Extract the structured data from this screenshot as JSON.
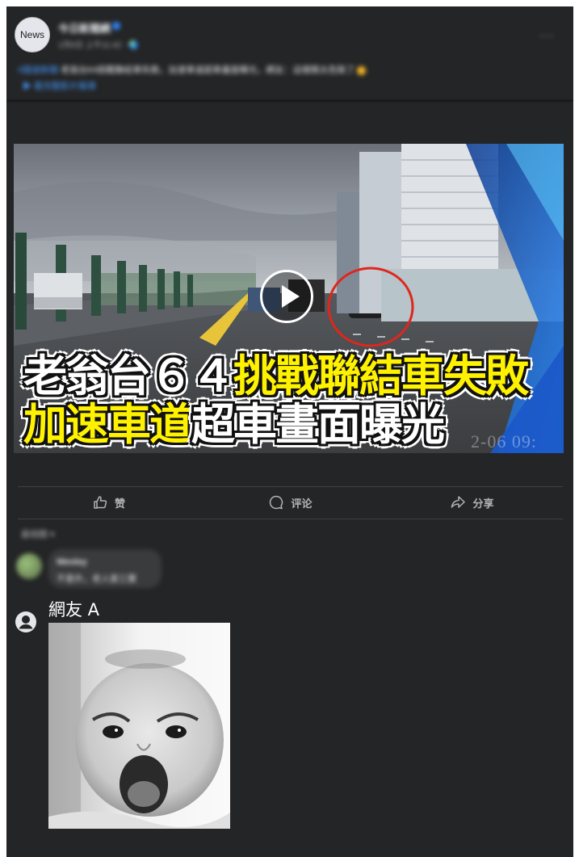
{
  "post": {
    "avatar_text": "News",
    "page_name": "今日新聞網",
    "meta": "1月6日 上午11:42 · 🌏",
    "more_label": "···",
    "text_tag": "#國道新聞",
    "text": "老翁台64挑戰聯結車失敗，加速車道超車畫面曝光，網友：這樣開太危險了",
    "text_link": "▶ 看完整影片報導"
  },
  "video": {
    "headline_line1_white": "老翁台６４",
    "headline_line1_yellow": "挑戰聯結車失敗",
    "headline_line2_yellow": "加速車道",
    "headline_line2_white": "超車畫面曝光",
    "timestamp": "2-06 09:"
  },
  "actions": {
    "like": "赞",
    "comment": "评论",
    "share": "分享"
  },
  "comments": {
    "sort_label": "最相關 ▾",
    "first_name": "Wesley",
    "first_body": "不意外，老人家三寶"
  },
  "reply": {
    "user_name": "網友 A"
  },
  "colors": {
    "background": "#242526",
    "highlight_yellow": "#fff200",
    "link_blue": "#4599ff"
  }
}
